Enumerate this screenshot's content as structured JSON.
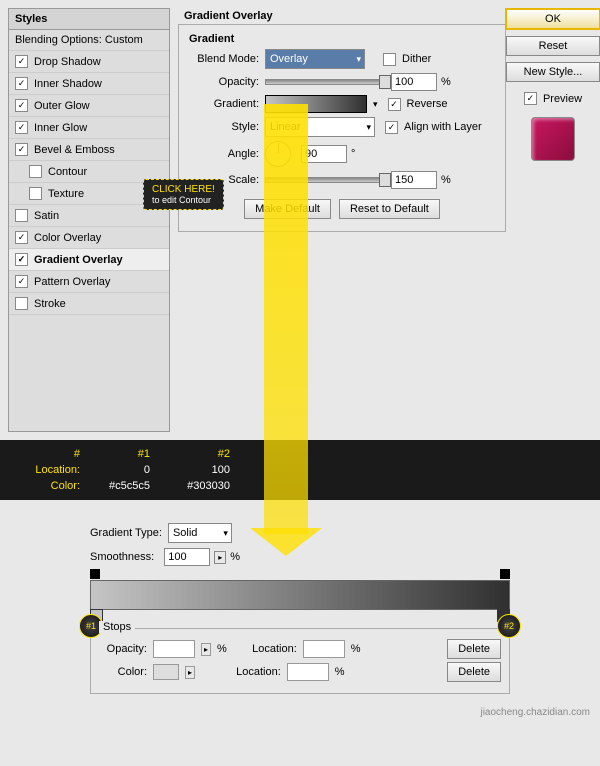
{
  "styles": {
    "header": "Styles",
    "blending": "Blending Options: Custom",
    "items": [
      {
        "label": "Drop Shadow",
        "checked": true
      },
      {
        "label": "Inner Shadow",
        "checked": true
      },
      {
        "label": "Outer Glow",
        "checked": true
      },
      {
        "label": "Inner Glow",
        "checked": true
      },
      {
        "label": "Bevel & Emboss",
        "checked": true
      },
      {
        "label": "Contour",
        "checked": false,
        "indent": true
      },
      {
        "label": "Texture",
        "checked": false,
        "indent": true
      },
      {
        "label": "Satin",
        "checked": false
      },
      {
        "label": "Color Overlay",
        "checked": true
      },
      {
        "label": "Gradient Overlay",
        "checked": true,
        "active": true
      },
      {
        "label": "Pattern Overlay",
        "checked": true
      },
      {
        "label": "Stroke",
        "checked": false
      }
    ]
  },
  "panel": {
    "title": "Gradient Overlay",
    "subtitle": "Gradient",
    "blendmode_label": "Blend Mode:",
    "blendmode": "Overlay",
    "dither": "Dither",
    "opacity_label": "Opacity:",
    "opacity": "100",
    "pct": "%",
    "gradient_label": "Gradient:",
    "reverse": "Reverse",
    "style_label": "Style:",
    "style": "Linear",
    "align": "Align with Layer",
    "angle_label": "Angle:",
    "angle": "90",
    "deg": "°",
    "scale_label": "Scale:",
    "scale": "150",
    "make_default": "Make Default",
    "reset_default": "Reset to Default"
  },
  "right": {
    "ok": "OK",
    "reset": "Reset",
    "new_style": "New Style...",
    "preview": "Preview"
  },
  "tooltip": {
    "line1": "CLICK HERE!",
    "line2": "to edit Contour"
  },
  "table": {
    "h": "#",
    "h1": "#1",
    "h2": "#2",
    "loc": "Location:",
    "loc1": "0",
    "loc2": "100",
    "col": "Color:",
    "col1": "#c5c5c5",
    "col2": "#303030"
  },
  "ge": {
    "type_label": "Gradient Type:",
    "type": "Solid",
    "smooth_label": "Smoothness:",
    "smooth": "100",
    "stops": "Stops",
    "opacity": "Opacity:",
    "location": "Location:",
    "color": "Color:",
    "delete": "Delete",
    "pct": "%",
    "b1": "#1",
    "b2": "#2"
  },
  "watermark": "jiaocheng.chazidian.com"
}
